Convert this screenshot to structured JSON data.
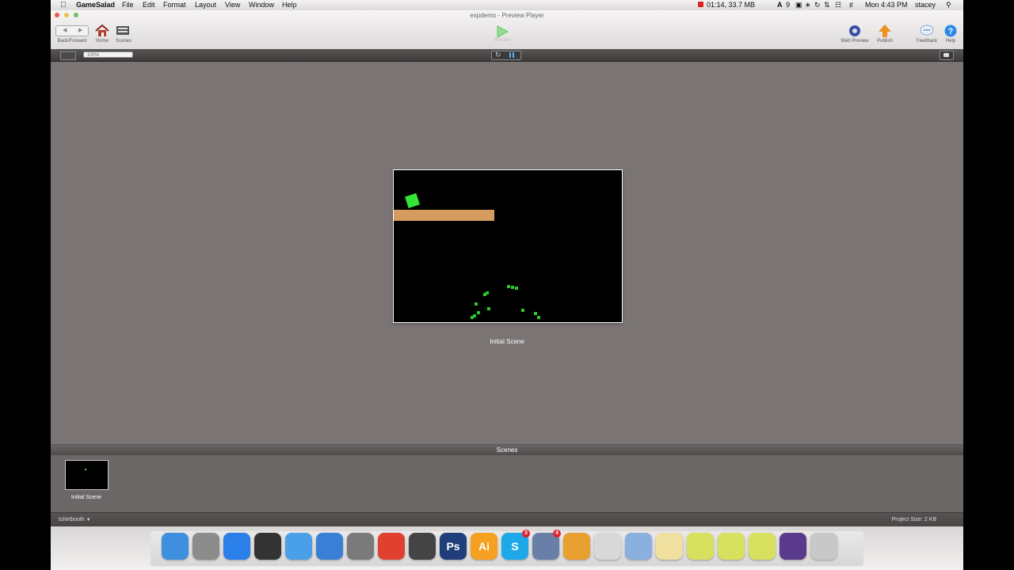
{
  "menubar": {
    "app_name": "GameSalad",
    "items": [
      "File",
      "Edit",
      "Format",
      "Layout",
      "View",
      "Window",
      "Help"
    ],
    "recording": "01:14, 33.7 MB",
    "ai_count": "9",
    "clock": "Mon 4:43 PM",
    "user": "stacey"
  },
  "window": {
    "title": "expdemo - Preview Player"
  },
  "toolbar": {
    "back_forward_label": "Back/Forward",
    "home_label": "Home",
    "scenes_label": "Scenes",
    "preview_label": "Preview",
    "web_preview_label": "Web Preview",
    "publish_label": "Publish",
    "feedback_label": "Feedback",
    "help_label": "Help"
  },
  "subbar": {
    "zoom_value": "100%"
  },
  "stage": {
    "scene_label": "Initial Scene"
  },
  "scenes_panel": {
    "header": "Scenes",
    "items": [
      {
        "label": "Initial Scene"
      }
    ]
  },
  "statusbar": {
    "account": "tshirtbooth",
    "project_size": "Project Size: 2 KB"
  },
  "dock": {
    "items": [
      {
        "name": "finder-icon",
        "label": "",
        "color": "#3f8fe0"
      },
      {
        "name": "launchpad-icon",
        "label": "",
        "color": "#8c8c8c"
      },
      {
        "name": "app-store-icon",
        "label": "",
        "color": "#2a7fe8"
      },
      {
        "name": "dashboard-icon",
        "label": "",
        "color": "#333333"
      },
      {
        "name": "safari-icon",
        "label": "",
        "color": "#4aa0e8"
      },
      {
        "name": "itunes-icon",
        "label": "",
        "color": "#3a7fd6"
      },
      {
        "name": "system-preferences-icon",
        "label": "",
        "color": "#7a7a7a"
      },
      {
        "name": "chrome-icon",
        "label": "",
        "color": "#e04030"
      },
      {
        "name": "imovie-icon",
        "label": "",
        "color": "#444444"
      },
      {
        "name": "photoshop-icon",
        "label": "Ps",
        "color": "#1f3e7a"
      },
      {
        "name": "illustrator-icon",
        "label": "Ai",
        "color": "#f5a020"
      },
      {
        "name": "skype-icon",
        "label": "S",
        "color": "#1fa8e8",
        "badge": "3"
      },
      {
        "name": "mail-icon",
        "label": "",
        "color": "#6a7fa8",
        "badge": "4"
      },
      {
        "name": "gamesalad-icon",
        "label": "",
        "color": "#e8a030"
      },
      {
        "name": "hand-icon",
        "label": "",
        "color": "#d8d8d8"
      },
      {
        "name": "folder-icon",
        "label": "",
        "color": "#8ab0e0"
      },
      {
        "name": "contacts-icon",
        "label": "",
        "color": "#f0e0a0"
      },
      {
        "name": "ps-doc-icon",
        "label": "",
        "color": "#d8e060"
      },
      {
        "name": "ai-doc-icon",
        "label": "",
        "color": "#d8e060"
      },
      {
        "name": "preview-doc-icon",
        "label": "",
        "color": "#d8e060"
      },
      {
        "name": "screen-doc-icon",
        "label": "",
        "color": "#5a3a8a"
      },
      {
        "name": "trash-icon",
        "label": "",
        "color": "#c8c8c8"
      }
    ]
  }
}
